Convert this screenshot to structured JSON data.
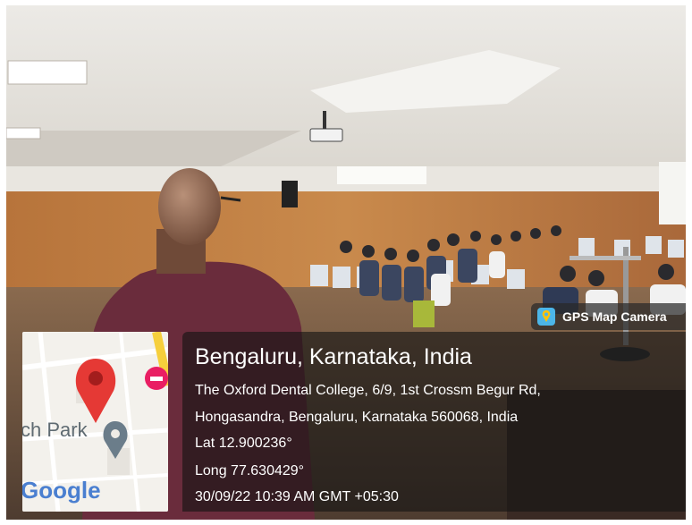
{
  "badge": {
    "label": "GPS Map Camera",
    "icon": "map-pin-camera-icon"
  },
  "location": {
    "title": "Bengaluru, Karnataka, India",
    "address_line1": "The Oxford Dental College, 6/9, 1st Crossm Begur Rd,",
    "address_line2": "Hongasandra, Bengaluru, Karnataka 560068, India",
    "lat": "Lat 12.900236°",
    "long": "Long 77.630429°",
    "timestamp": "30/09/22 10:39 AM GMT +05:30"
  },
  "map": {
    "place_label": "ch Park",
    "logo": "Google",
    "pin_color": "#e53935",
    "secondary_pin_color": "#6b7d8a",
    "poi_color": "#e91e63"
  }
}
